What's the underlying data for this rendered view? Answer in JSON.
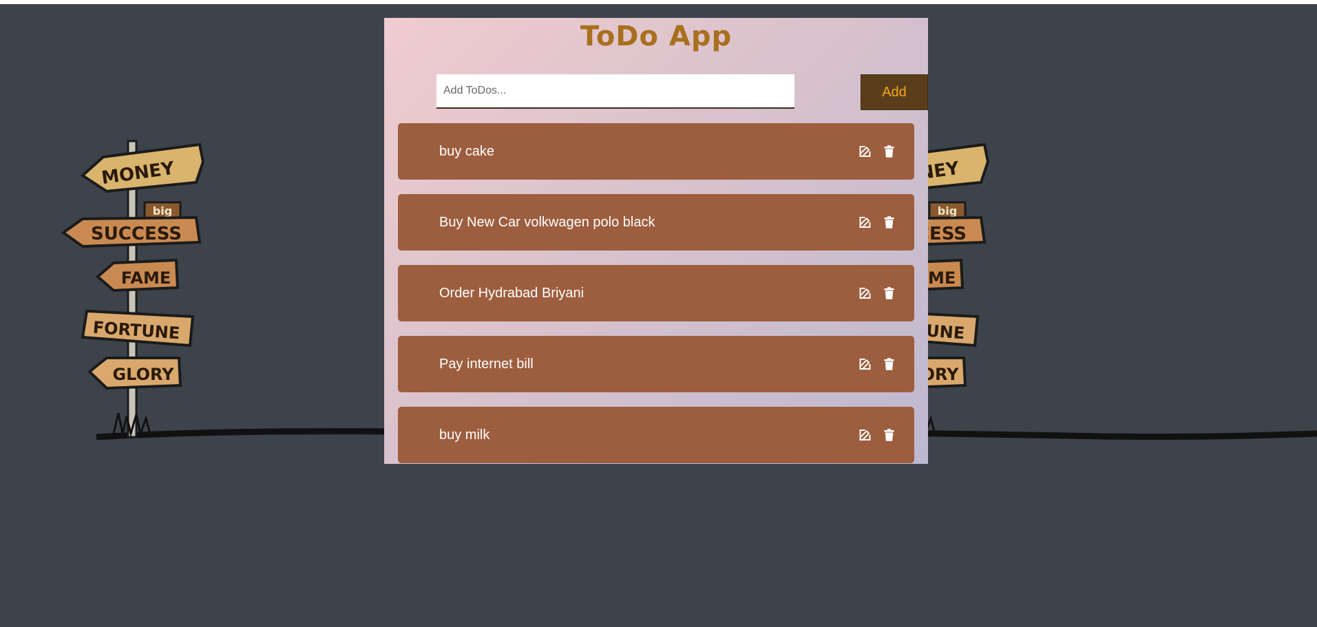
{
  "app": {
    "title": "ToDo App"
  },
  "form": {
    "input_value": "",
    "input_placeholder": "Add ToDos...",
    "add_label": "Add"
  },
  "todos": [
    {
      "text": "buy cake"
    },
    {
      "text": "Buy New Car volkwagen polo black"
    },
    {
      "text": "Order Hydrabad Briyani"
    },
    {
      "text": "Pay internet bill"
    },
    {
      "text": "buy milk"
    }
  ],
  "background": {
    "signpost_labels": [
      "MONEY",
      "big",
      "SUCCESS",
      "FAME",
      "FORTUNE",
      "GLORY"
    ]
  },
  "icons": {
    "edit": "edit-icon",
    "delete": "trash-icon"
  },
  "colors": {
    "page_background": "#3d434b",
    "title": "#a8701e",
    "add_button_bg": "#5a3e1c",
    "add_button_text": "#f2a81d",
    "todo_item_bg": "#9c5e3e",
    "todo_text": "#ffffff"
  }
}
